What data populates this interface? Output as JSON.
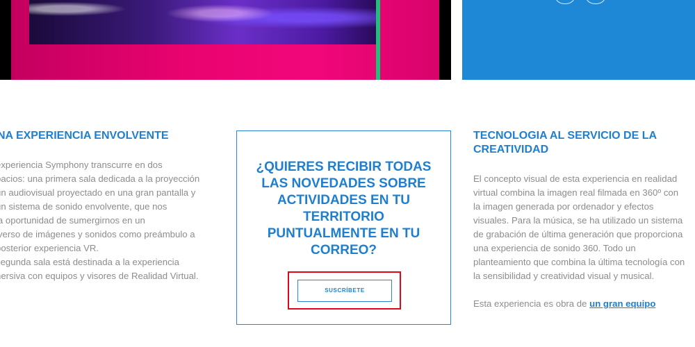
{
  "left_column": {
    "heading": "NA EXPERIENCIA ENVOLVENTE",
    "paragraph": "experiencia Symphony transcurre en dos\npacios: una primera sala dedicada a la proyección\nun audiovisual proyectado en una gran pantalla y\nun sistema de sonido envolvente, que nos\nla oportunidad de sumergirnos en un\niverso de imágenes y sonidos como preámbulo a\nposterior experiencia VR.\nsegunda sala está destinada a la experiencia\nnersiva con equipos y visores de Realidad Virtual."
  },
  "newsletter": {
    "title": "¿QUIERES RECIBIR TODAS LAS NOVEDADES SOBRE ACTIVIDADES EN TU TERRITORIO PUNTUALMENTE EN TU CORREO?",
    "button_label": "SUSCRÍBETE"
  },
  "right_column": {
    "heading": "TECNOLOGIA AL SERVICIO DE LA CREATIVIDAD",
    "paragraph": "El concepto visual de esta experiencia en realidad\nvirtual combina la imagen real filmada en 360º con\nla imagen generada por ordenador y efectos\nvisuales. Para la música, se ha utilizado un sistema\nde grabación de última generación que proporciona\nuna experiencia de sonido 360. Todo un\nplanteamiento que combina la última tecnología con\nla sensibilidad y creatividad visual y musical.",
    "credit_prefix": "Esta experiencia es obra de ",
    "credit_link": "un gran equipo"
  },
  "colors": {
    "accent_blue": "#1e7fd0",
    "panel_blue": "#1e87d6",
    "highlight_red": "#e0061a",
    "body_text": "#8c8c8c"
  }
}
